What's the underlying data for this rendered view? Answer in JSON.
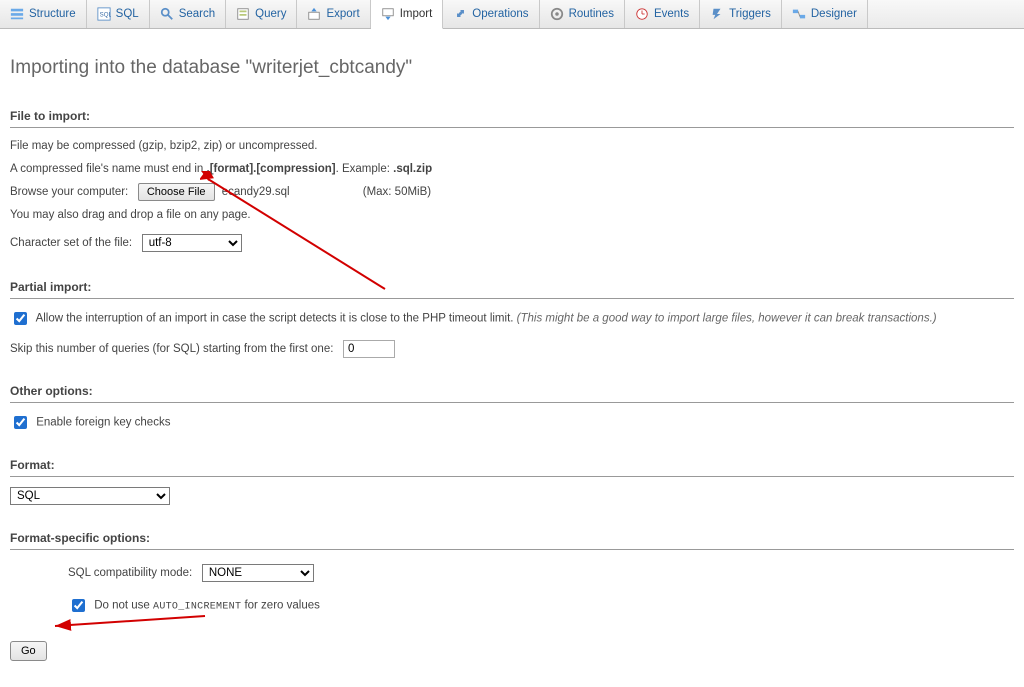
{
  "tabs": [
    {
      "label": "Structure",
      "icon": "structure"
    },
    {
      "label": "SQL",
      "icon": "sql"
    },
    {
      "label": "Search",
      "icon": "search"
    },
    {
      "label": "Query",
      "icon": "query"
    },
    {
      "label": "Export",
      "icon": "export"
    },
    {
      "label": "Import",
      "icon": "import",
      "active": true
    },
    {
      "label": "Operations",
      "icon": "operations"
    },
    {
      "label": "Routines",
      "icon": "routines"
    },
    {
      "label": "Events",
      "icon": "events"
    },
    {
      "label": "Triggers",
      "icon": "triggers"
    },
    {
      "label": "Designer",
      "icon": "designer"
    }
  ],
  "heading": "Importing into the database \"writerjet_cbtcandy\"",
  "sec_file": {
    "title": "File to import:",
    "hint1": "File may be compressed (gzip, bzip2, zip) or uncompressed.",
    "hint2a": "A compressed file's name must end in ",
    "hint2b": ".[format].[compression]",
    "hint2c": ". Example: ",
    "hint2d": ".sql.zip",
    "browse_label": "Browse your computer:",
    "choose_btn": "Choose File",
    "chosen_file": "ecandy29.sql",
    "max": "(Max: 50MiB)",
    "drag_hint": "You may also drag and drop a file on any page.",
    "charset_label": "Character set of the file:",
    "charset_value": "utf-8"
  },
  "sec_partial": {
    "title": "Partial import:",
    "cb_checked": true,
    "cb_text": "Allow the interruption of an import in case the script detects it is close to the PHP timeout limit.",
    "cb_note": " (This might be a good way to import large files, however it can break transactions.)",
    "skip_label": "Skip this number of queries (for SQL) starting from the first one:",
    "skip_value": "0"
  },
  "sec_other": {
    "title": "Other options:",
    "cb_checked": true,
    "cb_text": "Enable foreign key checks"
  },
  "sec_format": {
    "title": "Format:",
    "value": "SQL"
  },
  "sec_specific": {
    "title": "Format-specific options:",
    "compat_label": "SQL compatibility mode:",
    "compat_value": "NONE",
    "cb_checked": true,
    "cb_text_a": "Do not use ",
    "cb_text_b": "AUTO_INCREMENT",
    "cb_text_c": " for zero values"
  },
  "go": "Go"
}
